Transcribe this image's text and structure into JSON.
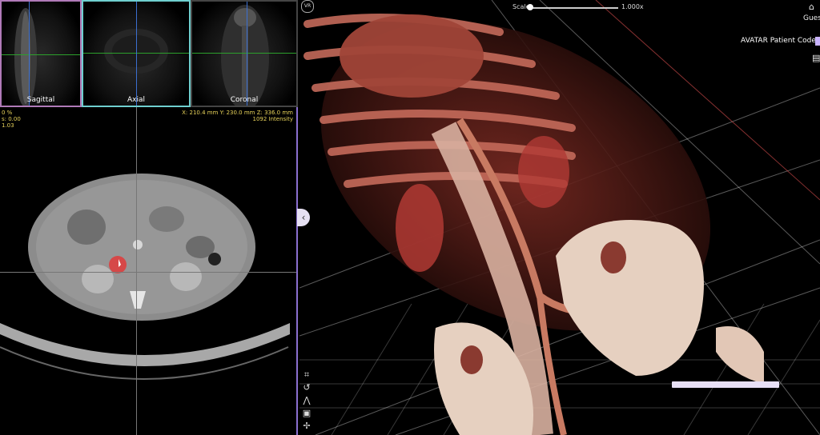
{
  "thumbnails": {
    "sagittal": "Sagittal",
    "axial": "Axial",
    "coronal": "Coronal"
  },
  "readouts": {
    "left": [
      "0 %",
      "s: 0.00",
      "1.03"
    ],
    "right_line1": "X: 210.4 mm Y: 230.0 mm Z: 336.0 mm",
    "right_line2": "1092 Intensity"
  },
  "viewer": {
    "vr_badge": "VR",
    "scale_label": "Scale",
    "scale_value": "1.000x",
    "scale_fraction": 0.0
  },
  "header": {
    "user": "Gues",
    "patient_code_label": "AVATAR Patient Code"
  },
  "icons": {
    "home": "home-icon",
    "document": "document-icon",
    "collapse": "chevron-left-icon",
    "tools": [
      "crop-icon",
      "lasso-icon",
      "measure-icon",
      "save-icon",
      "pin-icon"
    ]
  },
  "colors": {
    "sagittal_border": "#b07ab8",
    "axial_border": "#6fcfcf",
    "crosshair_h": "#2ca02c",
    "crosshair_v": "#3b6fd0",
    "readout": "#e8d35a",
    "panel_divider": "#8a6fcf",
    "marker": "#e03a3a",
    "bone": "#e9d6c6",
    "tissue": "#8a2c22"
  }
}
